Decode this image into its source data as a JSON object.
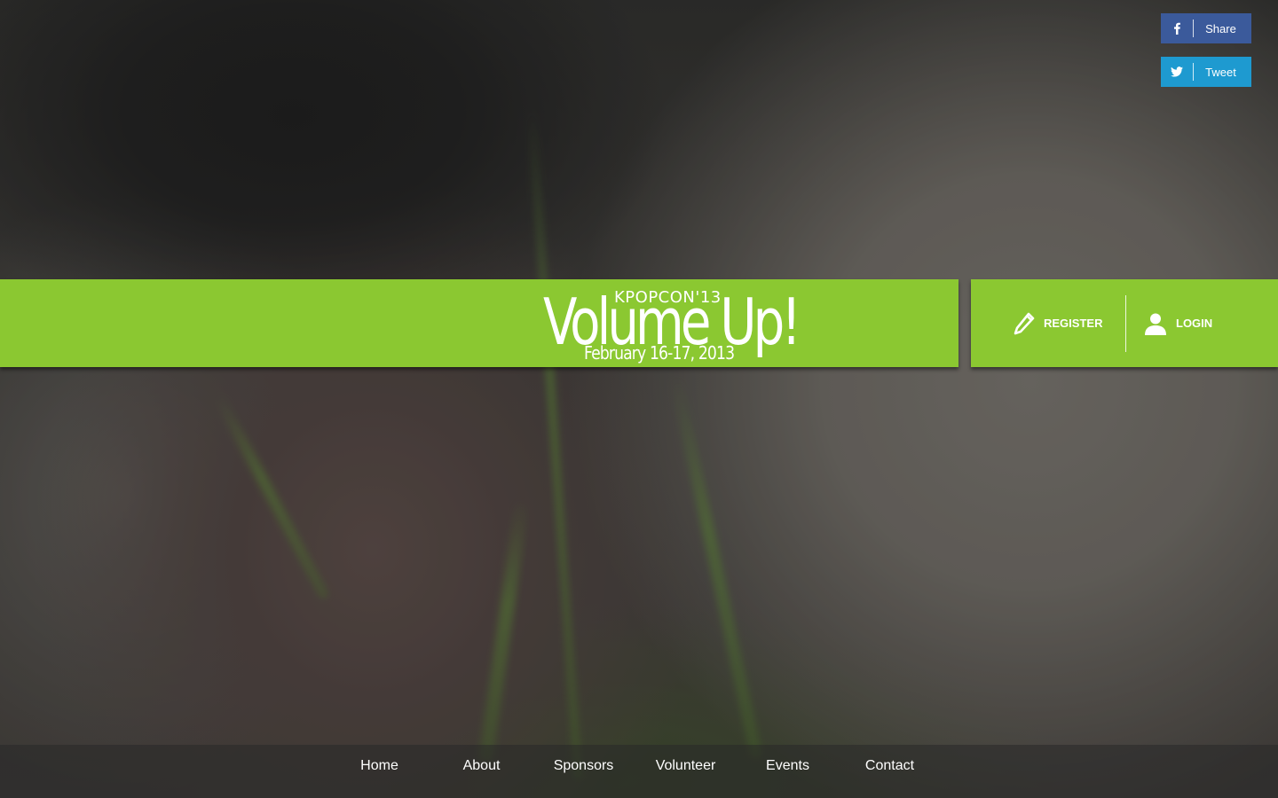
{
  "social": {
    "share": {
      "label": "Share",
      "icon": "facebook-icon",
      "color": "#3b5a9b"
    },
    "tweet": {
      "label": "Tweet",
      "icon": "twitter-icon",
      "color": "#1e9ad0"
    }
  },
  "banner": {
    "color": "#8bc831",
    "logo": {
      "kicker": "KPOPCON'13",
      "title": "Volume Up!",
      "date": "February 16-17, 2013"
    }
  },
  "account": {
    "register_label": "REGISTER",
    "register_icon": "pencil-icon",
    "login_label": "LOGIN",
    "login_icon": "user-icon"
  },
  "nav": {
    "items": [
      "Home",
      "About",
      "Sponsors",
      "Volunteer",
      "Events",
      "Contact"
    ]
  }
}
